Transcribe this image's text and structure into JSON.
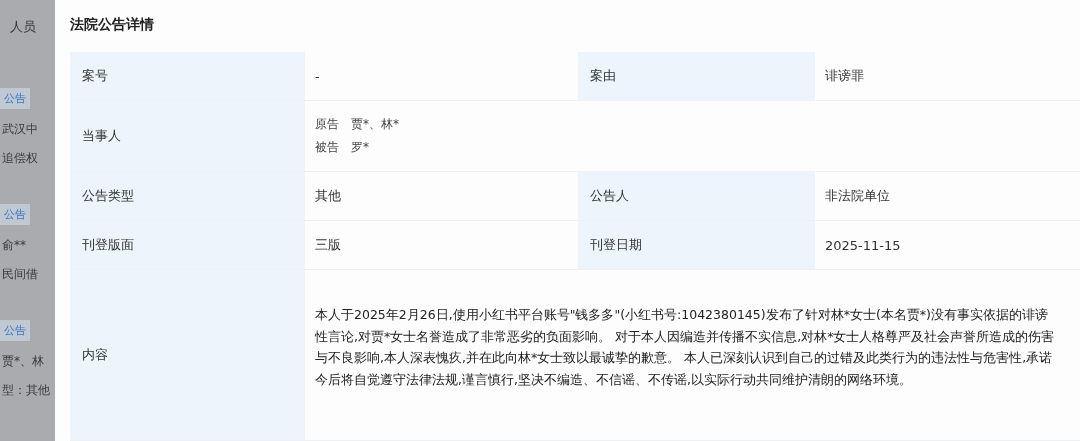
{
  "background_page": {
    "header": "人员",
    "items": [
      {
        "tag": "公告",
        "lines": [
          "武汉中",
          "追偿权"
        ]
      },
      {
        "tag": "公告",
        "lines": [
          "俞**",
          "民间借"
        ]
      },
      {
        "tag": "公告",
        "lines": [
          "贾*、林",
          "型：其他"
        ]
      }
    ]
  },
  "dialog": {
    "title": "法院公告详情",
    "rows": [
      {
        "kind": "pair",
        "cells": [
          {
            "label": "案号",
            "value": "-"
          },
          {
            "label": "案由",
            "value": "诽谤罪"
          }
        ]
      },
      {
        "kind": "parties",
        "label": "当事人",
        "parties": [
          {
            "role": "原告",
            "names": "贾*、林*"
          },
          {
            "role": "被告",
            "names": "罗*"
          }
        ]
      },
      {
        "kind": "pair",
        "cells": [
          {
            "label": "公告类型",
            "value": "其他"
          },
          {
            "label": "公告人",
            "value": "非法院单位"
          }
        ]
      },
      {
        "kind": "pair",
        "cells": [
          {
            "label": "刊登版面",
            "value": "三版"
          },
          {
            "label": "刊登日期",
            "value": "2025-11-15"
          }
        ]
      },
      {
        "kind": "content",
        "label": "内容",
        "text": "本人于2025年2月26日,使用小红书平台账号\"钱多多\"(小红书号:1042380145)发布了针对林*女士(本名贾*)没有事实依据的诽谤性言论,对贾*女士名誉造成了非常恶劣的负面影响。 对于本人因编造并传播不实信息,对林*女士人格尊严及社会声誉所造成的伤害与不良影响,本人深表愧疚,并在此向林*女士致以最诚挚的歉意。 本人已深刻认识到自己的过错及此类行为的违法性与危害性,承诺今后将自觉遵守法律法规,谨言慎行,坚决不编造、不信谣、不传谣,以实际行动共同维护清朗的网络环境。"
      }
    ]
  }
}
